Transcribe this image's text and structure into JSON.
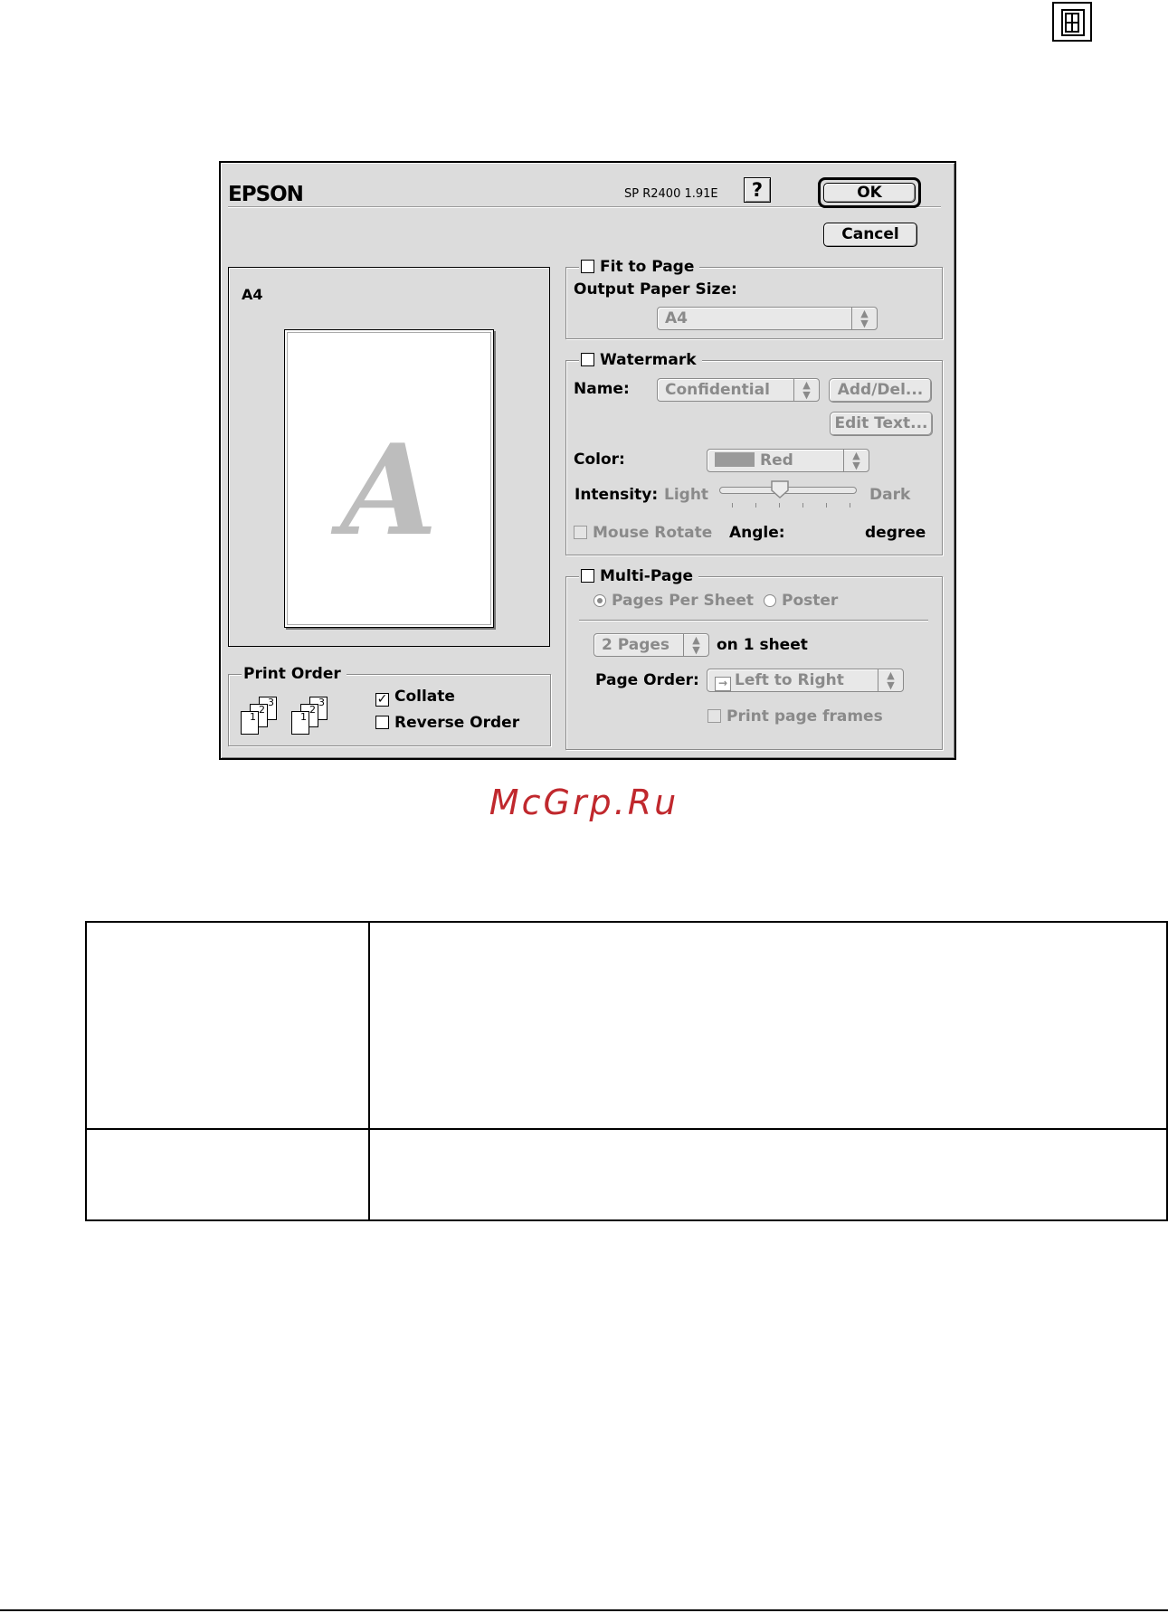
{
  "dialog": {
    "brand": "EPSON",
    "version": "SP R2400 1.91E",
    "help_label": "?",
    "ok_label": "OK",
    "cancel_label": "Cancel"
  },
  "preview": {
    "paper_label": "A4",
    "watermark_letter": "A"
  },
  "fit_to_page": {
    "title": "Fit to Page",
    "checked": false,
    "output_label": "Output Paper Size:",
    "paper_size": "A4"
  },
  "watermark": {
    "title": "Watermark",
    "checked": false,
    "name_label": "Name:",
    "name_value": "Confidential",
    "add_del_label": "Add/Del...",
    "edit_text_label": "Edit Text...",
    "color_label": "Color:",
    "color_value": "Red",
    "intensity_label": "Intensity:",
    "light_label": "Light",
    "dark_label": "Dark",
    "intensity_level": 0.4,
    "mouse_rotate_label": "Mouse Rotate",
    "angle_label": "Angle:",
    "degree_label": "degree"
  },
  "multi_page": {
    "title": "Multi-Page",
    "checked": false,
    "pages_per_sheet_label": "Pages Per Sheet",
    "poster_label": "Poster",
    "selected_mode": "Pages Per Sheet",
    "pages_value": "2 Pages",
    "on_sheet_label": "on 1 sheet",
    "page_order_label": "Page Order:",
    "page_order_value": "Left to Right",
    "print_frames_label": "Print page frames"
  },
  "print_order": {
    "title": "Print Order",
    "collate_label": "Collate",
    "collate_checked": true,
    "reverse_label": "Reverse Order",
    "reverse_checked": false,
    "stack_numbers": [
      "1",
      "2",
      "3"
    ]
  },
  "watermark_site": "McGrp.Ru",
  "colors": {
    "dialog_bg": "#dcdcdc",
    "disabled_text": "#8a8a8a",
    "site_red": "#c0282d"
  }
}
